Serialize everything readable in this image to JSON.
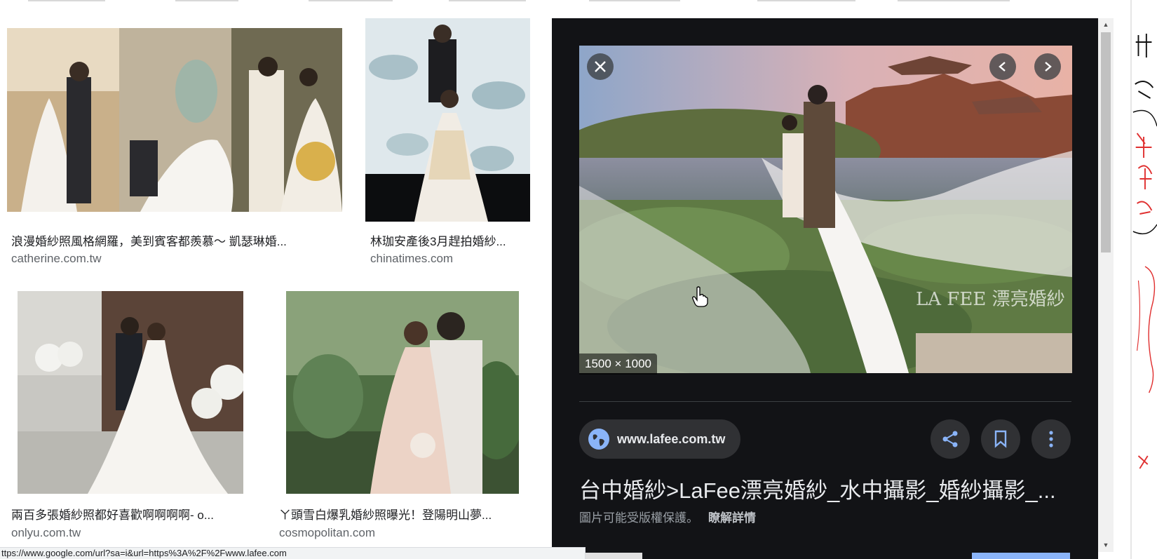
{
  "results": [
    {
      "title": "浪漫婚紗照風格網羅，美到賓客都羨慕～ 凱瑟琳婚...",
      "domain": "catherine.com.tw",
      "image_alt": "wedding-collage"
    },
    {
      "title": "林珈安產後3月趕拍婚紗...",
      "domain": "chinatimes.com",
      "image_alt": "couple-leaf-backdrop"
    },
    {
      "title": "兩百多張婚紗照都好喜歡啊啊啊啊- o...",
      "domain": "onlyu.com.tw",
      "image_alt": "couple-bench-flowers"
    },
    {
      "title": "ㄚ頭雪白爆乳婚紗照曝光！登陽明山夢...",
      "domain": "cosmopolitan.com",
      "image_alt": "couple-kiss-forest"
    }
  ],
  "preview": {
    "dimensions": "1500 × 1000",
    "watermark": "LA FEE 漂亮婚紗",
    "source_domain": "www.lafee.com.tw",
    "title": "台中婚紗>LaFee漂亮婚紗_水中攝影_婚紗攝影_...",
    "copyright_notice": "圖片可能受版權保護。",
    "learn_more": "瞭解詳情"
  },
  "icons": {
    "close": "close-icon",
    "prev": "chevron-left-icon",
    "next": "chevron-right-icon",
    "globe": "globe-icon",
    "share": "share-icon",
    "save": "bookmark-icon",
    "more": "more-vert-icon"
  },
  "status_bar": {
    "url": "ttps://www.google.com/url?sa=i&url=https%3A%2F%2Fwww.lafee.com"
  },
  "colors": {
    "panel_bg": "#121316",
    "chip_bg": "#303134",
    "accent_blue": "#8ab4f8"
  }
}
